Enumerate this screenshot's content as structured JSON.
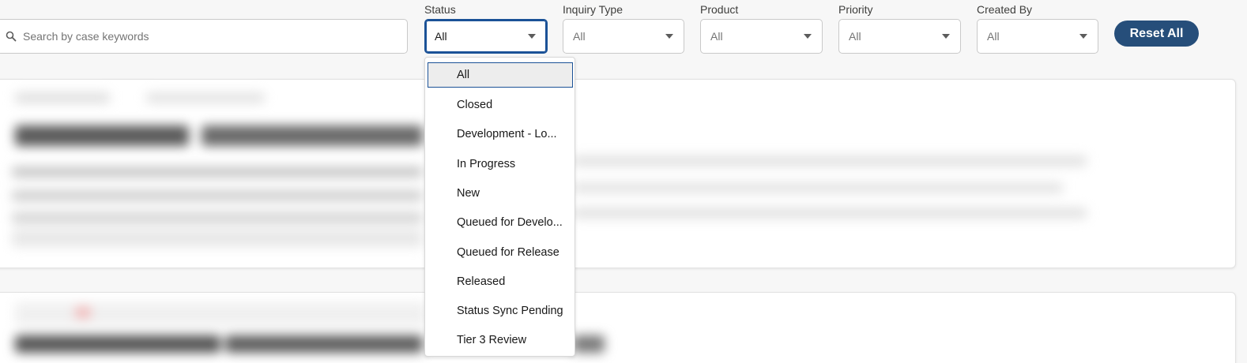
{
  "search": {
    "placeholder": "Search by case keywords"
  },
  "filters": [
    {
      "label": "Status",
      "value": "All"
    },
    {
      "label": "Inquiry Type",
      "value": "All"
    },
    {
      "label": "Product",
      "value": "All"
    },
    {
      "label": "Priority",
      "value": "All"
    },
    {
      "label": "Created By",
      "value": "All"
    }
  ],
  "reset_label": "Reset All",
  "status_dropdown": {
    "options": [
      "All",
      "Closed",
      "Development - Lo...",
      "In Progress",
      "New",
      "Queued for Develo...",
      "Queued for Release",
      "Released",
      "Status Sync Pending",
      "Tier 3 Review"
    ],
    "selected": "All"
  },
  "colors": {
    "accent_blue": "#1b5297",
    "reset_button": "#264e7a",
    "background": "#f7f7f7"
  },
  "icons": {
    "search": "search-icon",
    "chevron": "chevron-down-icon"
  }
}
